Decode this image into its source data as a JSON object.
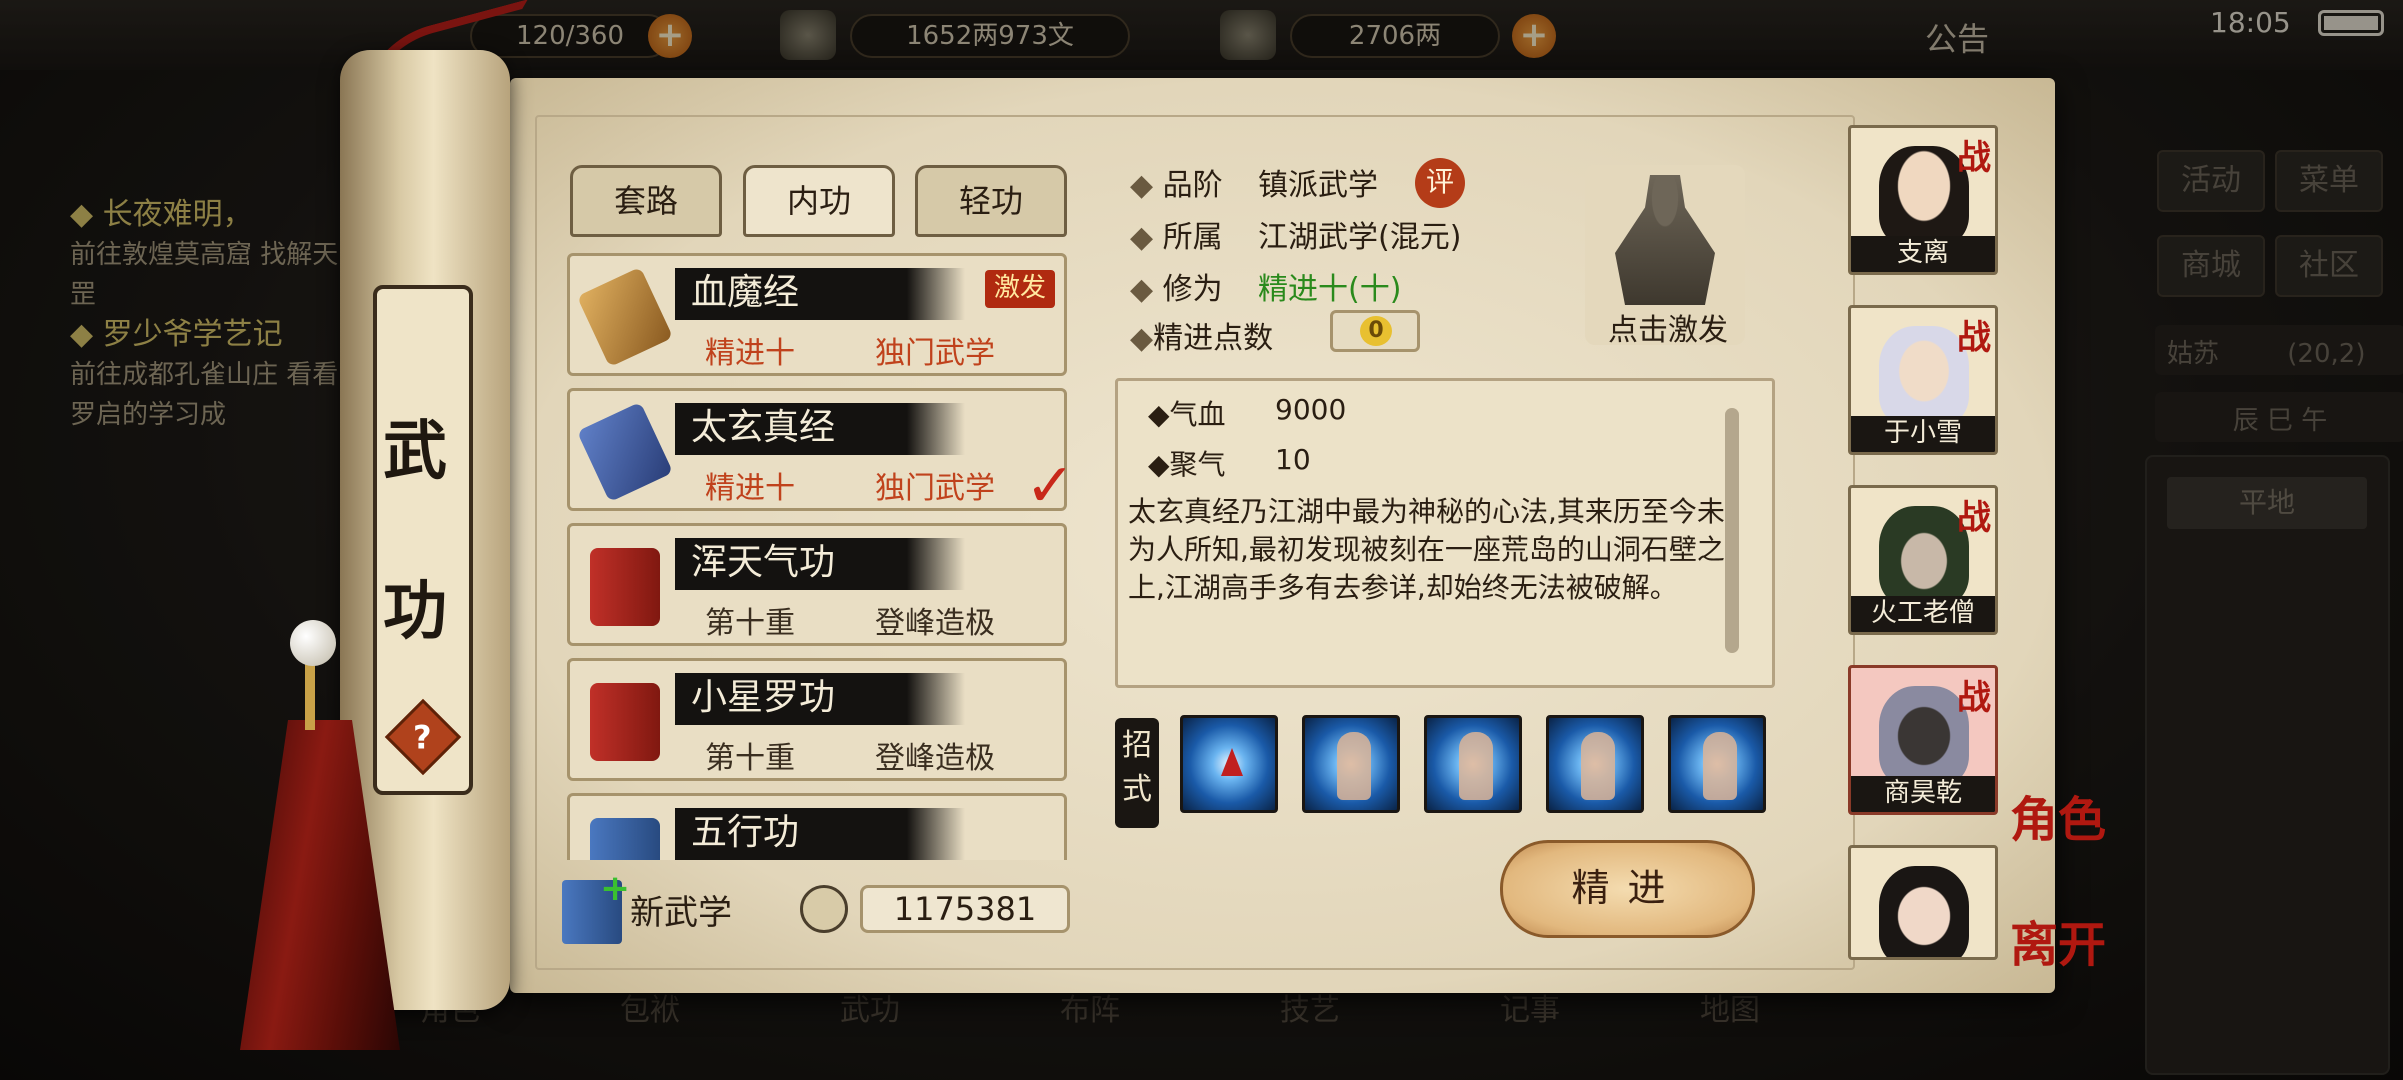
{
  "topbar": {
    "stamina": "120/360",
    "money": "1652两973文",
    "gold": "2706两",
    "announce": "公告",
    "clock": "18:05"
  },
  "left_quests": [
    {
      "title": "◆ 长夜难明，",
      "desc": "前往敦煌莫高窟 找解天罡"
    },
    {
      "title": "◆ 罗少爷学艺记",
      "desc": "前往成都孔雀山庄 看看罗启的学习成"
    }
  ],
  "right_panel": {
    "activity": "活动",
    "menu": "菜单",
    "shop": "商城",
    "community": "社区",
    "location": "姑苏",
    "coords": "(20,2)",
    "time_of_day": "辰 巳 午",
    "terrain": "平地"
  },
  "bottom_nav": [
    "角色",
    "包袱",
    "武功",
    "布阵",
    "技艺",
    "记事",
    "地图"
  ],
  "scroll": {
    "title_top": "武",
    "title_bottom": "功",
    "help": "?"
  },
  "tabs": [
    {
      "label": "套路",
      "active": false
    },
    {
      "label": "内功",
      "active": true
    },
    {
      "label": "轻功",
      "active": false
    }
  ],
  "skills": [
    {
      "name": "血魔经",
      "level": "精进十",
      "type": "独门武学",
      "badge": "激发",
      "icon": "scroll-icon",
      "highlight": true,
      "checked": false
    },
    {
      "name": "太玄真经",
      "level": "精进十",
      "type": "独门武学",
      "badge": "",
      "icon": "blue-scroll-icon",
      "highlight": true,
      "checked": true
    },
    {
      "name": "浑天气功",
      "level": "第十重",
      "type": "登峰造极",
      "badge": "",
      "icon": "red-book-icon",
      "highlight": false,
      "checked": false
    },
    {
      "name": "小星罗功",
      "level": "第十重",
      "type": "登峰造极",
      "badge": "",
      "icon": "red-book-icon",
      "highlight": false,
      "checked": false
    },
    {
      "name": "五行功",
      "level": "",
      "type": "",
      "badge": "",
      "icon": "blue-book-icon",
      "highlight": false,
      "checked": false
    }
  ],
  "footer": {
    "new_skill": "新武学",
    "points": "1175381"
  },
  "detail": {
    "grade_label": "品阶",
    "grade_value": "镇派武学",
    "grade_badge": "评",
    "belong_label": "所属",
    "belong_value": "江湖武学(混元)",
    "cult_label": "修为",
    "cult_value": "精进十(十)",
    "refine_label": "精进点数",
    "refine_value": "0",
    "activate_label": "点击激发",
    "stats": [
      {
        "label": "◆气血",
        "value": "9000"
      },
      {
        "label": "◆聚气",
        "value": "10"
      }
    ],
    "description": "太玄真经乃江湖中最为神秘的心法,其来历至今未为人所知,最初发现被刻在一座荒岛的山洞石壁之上,江湖高手多有去参详,却始终无法被破解。",
    "moves_label": "招式",
    "moves": [
      "move-1",
      "move-2",
      "move-3",
      "move-4",
      "move-5"
    ],
    "refine_button": "精进"
  },
  "characters": [
    {
      "name": "支离",
      "tag": "战",
      "selected": false
    },
    {
      "name": "于小雪",
      "tag": "战",
      "selected": false
    },
    {
      "name": "火工老僧",
      "tag": "战",
      "selected": false
    },
    {
      "name": "商昊乾",
      "tag": "战",
      "selected": true
    },
    {
      "name": "",
      "tag": "",
      "selected": false
    }
  ],
  "side_tabs": {
    "role": "角色",
    "leave": "离开"
  },
  "colors": {
    "accent_red": "#b01810",
    "paper": "#e2d6ba",
    "cultivation_green": "#2a8a1c"
  }
}
